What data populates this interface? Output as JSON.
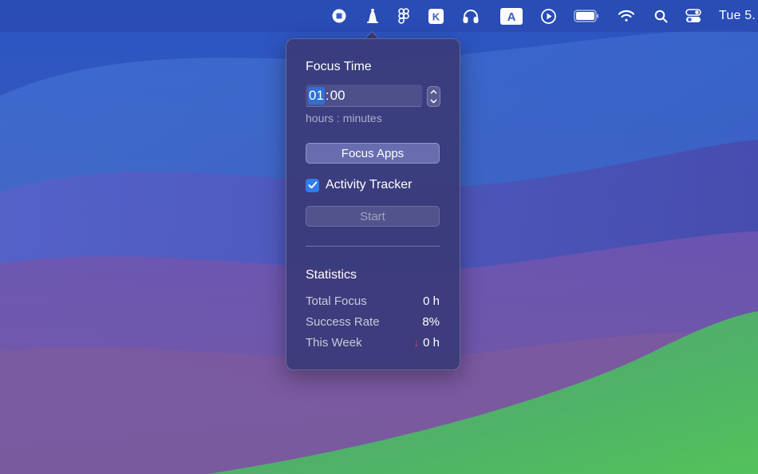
{
  "menubar": {
    "icons": [
      "stop-icon",
      "focus-app-icon",
      "figma-icon",
      "k-app-icon",
      "headphones-icon",
      "input-source-icon",
      "play-circle-icon",
      "battery-icon",
      "wifi-icon",
      "search-icon",
      "control-center-icon"
    ],
    "input_source_label": "A",
    "k_app_label": "K",
    "clock": "Tue 5."
  },
  "popover": {
    "focus_time_title": "Focus Time",
    "time_hours": "01",
    "time_separator": ":",
    "time_minutes": "00",
    "time_hint": "hours : minutes",
    "focus_apps_label": "Focus Apps",
    "activity_tracker_label": "Activity Tracker",
    "activity_tracker_checked": true,
    "start_label": "Start",
    "statistics_title": "Statistics",
    "stats": [
      {
        "label": "Total Focus",
        "value": "0 h"
      },
      {
        "label": "Success Rate",
        "value": "8%"
      },
      {
        "label": "This Week",
        "value": "0 h",
        "trend_icon": "arrow-down-icon",
        "trend": "↓"
      }
    ]
  },
  "colors": {
    "accent": "#2f7cf0",
    "trend_down": "#e5484d"
  }
}
